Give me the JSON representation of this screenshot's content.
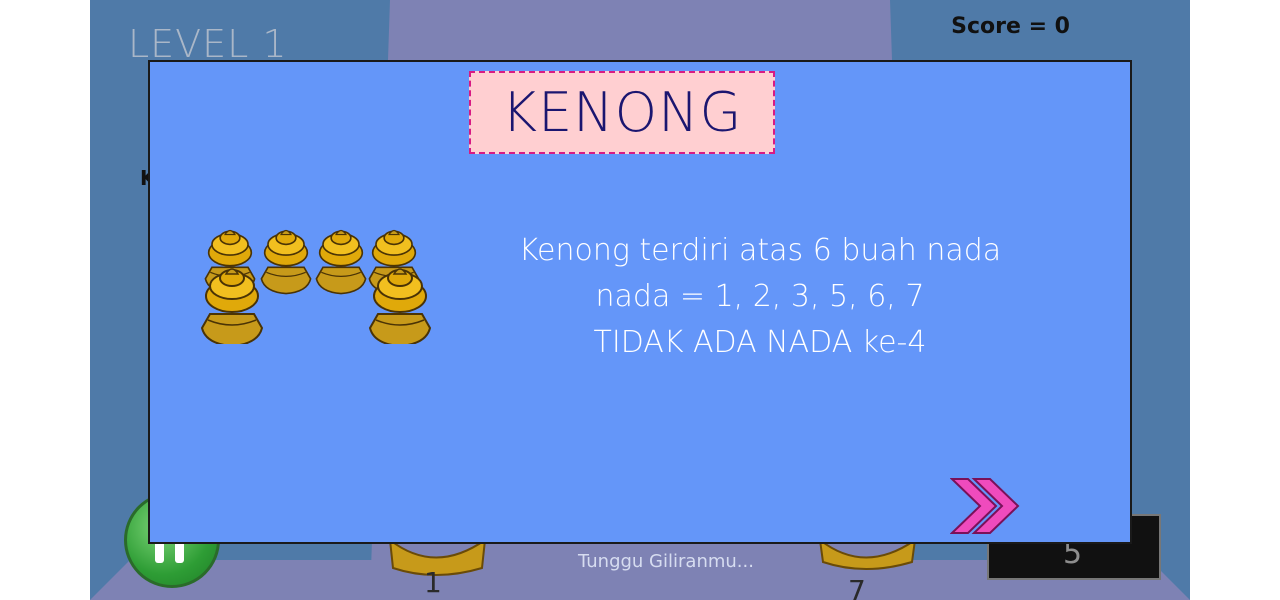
{
  "hud": {
    "level": "LEVEL 1",
    "score": "Score = 0",
    "side_fragment": "K"
  },
  "game": {
    "status": "Tunggu Giliranmu...",
    "note_left": "1",
    "note_right": "7",
    "answer_value": "5"
  },
  "dialog": {
    "title": "KENONG",
    "lines": [
      "Kenong terdiri atas 6 buah nada",
      "nada = 1, 2, 3, 5, 6, 7",
      "TIDAK ADA NADA ke-4"
    ],
    "next_icon": "double-chevron-right-icon"
  },
  "colors": {
    "stage": "#4f7aa8",
    "dialog_bg": "#6496f9",
    "title_box": "#ffcfd1",
    "title_border": "#d81a84",
    "title_text": "#1b1670",
    "next_button": "#ef4bbd",
    "gong_gold": "#e0a90a",
    "gong_base": "#c79a1a"
  }
}
